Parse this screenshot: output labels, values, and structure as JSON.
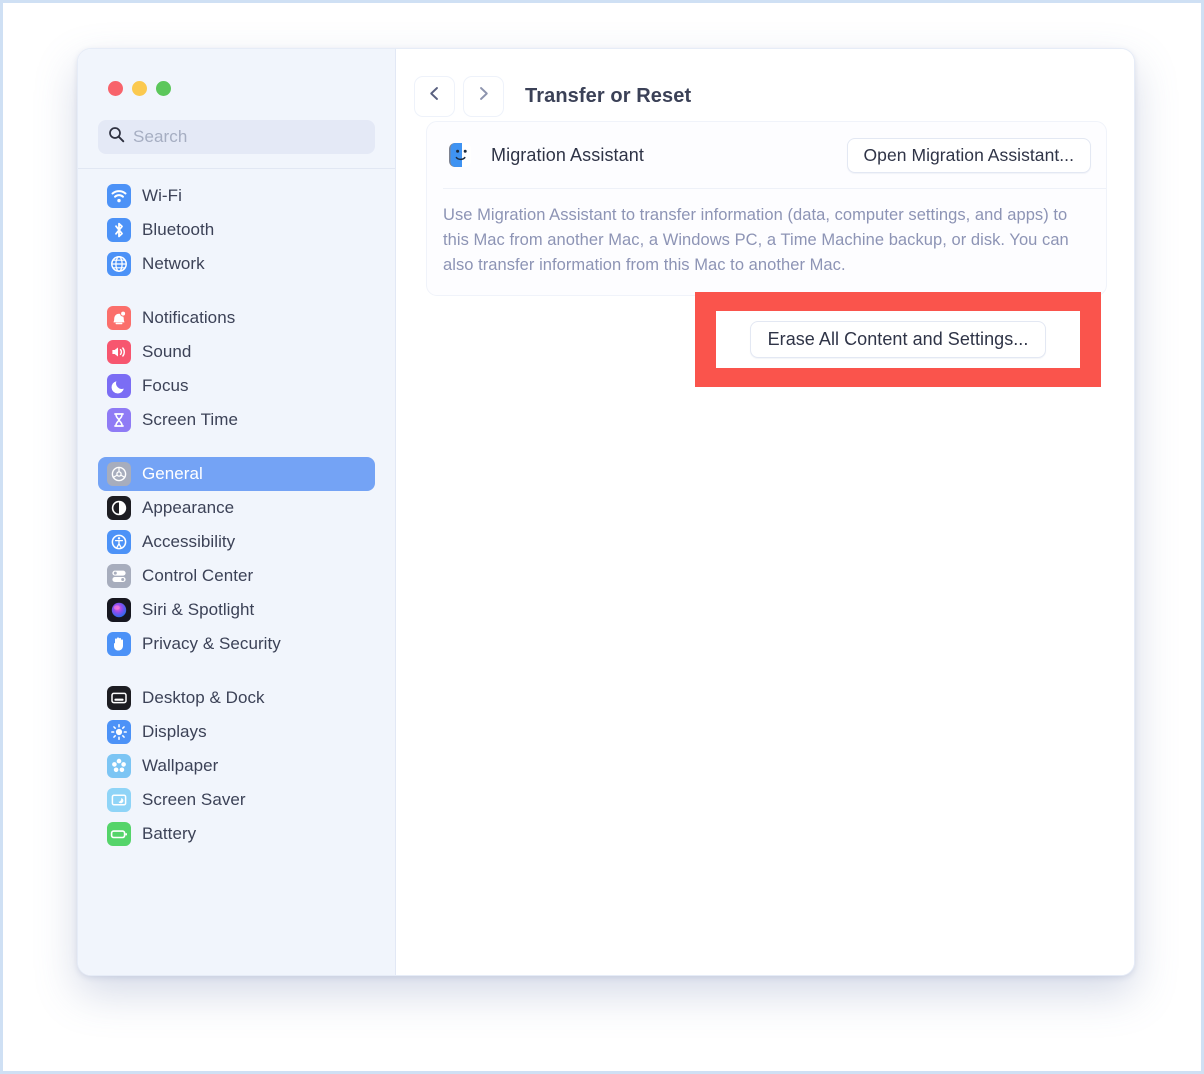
{
  "window": {
    "traffic_lights": [
      {
        "name": "close-button",
        "color": "#f8636b"
      },
      {
        "name": "minimize-button",
        "color": "#fbc94f"
      },
      {
        "name": "maximize-button",
        "color": "#5cc75b"
      }
    ]
  },
  "search": {
    "placeholder": "Search",
    "value": "",
    "icon": "search-icon"
  },
  "sidebar": {
    "groups": [
      {
        "items": [
          {
            "label": "Wi-Fi",
            "icon": "wifi-icon",
            "selected": false
          },
          {
            "label": "Bluetooth",
            "icon": "bluetooth-icon",
            "selected": false
          },
          {
            "label": "Network",
            "icon": "globe-icon",
            "selected": false
          }
        ]
      },
      {
        "items": [
          {
            "label": "Notifications",
            "icon": "bell-icon",
            "selected": false
          },
          {
            "label": "Sound",
            "icon": "speaker-icon",
            "selected": false
          },
          {
            "label": "Focus",
            "icon": "moon-icon",
            "selected": false
          },
          {
            "label": "Screen Time",
            "icon": "hourglass-icon",
            "selected": false
          }
        ]
      },
      {
        "items": [
          {
            "label": "General",
            "icon": "gear-icon",
            "selected": true
          },
          {
            "label": "Appearance",
            "icon": "contrast-circle-icon",
            "selected": false
          },
          {
            "label": "Accessibility",
            "icon": "accessibility-icon",
            "selected": false
          },
          {
            "label": "Control Center",
            "icon": "toggles-icon",
            "selected": false
          },
          {
            "label": "Siri & Spotlight",
            "icon": "siri-orb-icon",
            "selected": false
          },
          {
            "label": "Privacy & Security",
            "icon": "hand-icon",
            "selected": false
          }
        ]
      },
      {
        "items": [
          {
            "label": "Desktop & Dock",
            "icon": "desktop-dock-icon",
            "selected": false
          },
          {
            "label": "Displays",
            "icon": "brightness-icon",
            "selected": false
          },
          {
            "label": "Wallpaper",
            "icon": "wallpaper-flower-icon",
            "selected": false
          },
          {
            "label": "Screen Saver",
            "icon": "screen-saver-icon",
            "selected": false
          },
          {
            "label": "Battery",
            "icon": "battery-icon",
            "selected": false
          }
        ]
      }
    ]
  },
  "header": {
    "back_icon": "chevron-left-icon",
    "forward_icon": "chevron-right-icon",
    "title": "Transfer or Reset"
  },
  "migration": {
    "icon": "migration-assistant-icon",
    "label": "Migration Assistant",
    "open_button": "Open Migration Assistant...",
    "description": "Use Migration Assistant to transfer information (data, computer settings, and apps) to this Mac from another Mac, a Windows PC, a Time Machine backup, or disk. You can also transfer information from this Mac to another Mac."
  },
  "erase": {
    "button_label": "Erase All Content and Settings...",
    "highlight_color": "#fa544c"
  },
  "colors": {
    "accent_selected": "#74a3f5",
    "sidebar_bg": "#f1f5fc",
    "page_border": "#cfe0f4",
    "highlight_red": "#fa544c"
  }
}
